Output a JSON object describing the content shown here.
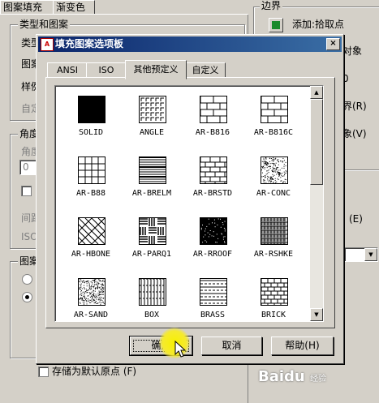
{
  "background": {
    "tabs": [
      "图案填充",
      "渐变色"
    ],
    "type_group": {
      "label": "类型和图案",
      "rows": [
        "类型",
        "图案",
        "样例",
        "自定"
      ]
    },
    "angle_group": {
      "label": "角度",
      "rows": [
        "角度",
        "0",
        "间距",
        "ISO"
      ]
    },
    "origin_group": {
      "label": "图案"
    },
    "store_default_origin": "存储为默认原点 (F)",
    "border_group": {
      "label": "边界",
      "add_pick_point": "添加:拾取点",
      "partial": [
        "对象",
        "0",
        "界(R)",
        "象(V)",
        "(E)"
      ]
    }
  },
  "dialog": {
    "title": "填充图案选项板",
    "close_icon": "×",
    "tabs": [
      {
        "label": "ANSI",
        "active": false
      },
      {
        "label": "ISO",
        "active": false
      },
      {
        "label": "其他预定义",
        "active": true
      },
      {
        "label": "自定义",
        "active": false
      }
    ],
    "patterns": [
      {
        "name": "SOLID",
        "icon": "solid-fill"
      },
      {
        "name": "ANGLE",
        "icon": "angle-grid"
      },
      {
        "name": "AR-B816",
        "icon": "brick-large"
      },
      {
        "name": "AR-B816C",
        "icon": "brick-large-c"
      },
      {
        "name": "AR-B88",
        "icon": "brick-square"
      },
      {
        "name": "AR-BRELM",
        "icon": "brick-elm"
      },
      {
        "name": "AR-BRSTD",
        "icon": "brick-std"
      },
      {
        "name": "AR-CONC",
        "icon": "concrete"
      },
      {
        "name": "AR-HBONE",
        "icon": "herringbone"
      },
      {
        "name": "AR-PARQ1",
        "icon": "parquet"
      },
      {
        "name": "AR-RROOF",
        "icon": "roof-dots"
      },
      {
        "name": "AR-RSHKE",
        "icon": "roof-shake"
      },
      {
        "name": "AR-SAND",
        "icon": "sand"
      },
      {
        "name": "BOX",
        "icon": "box-lines"
      },
      {
        "name": "BRASS",
        "icon": "brass-lines"
      },
      {
        "name": "BRICK",
        "icon": "brick"
      }
    ],
    "buttons": {
      "ok": "确定",
      "cancel": "取消",
      "help": "帮助(H)"
    }
  },
  "watermark": {
    "text": "Baidu",
    "sub": "经验"
  }
}
